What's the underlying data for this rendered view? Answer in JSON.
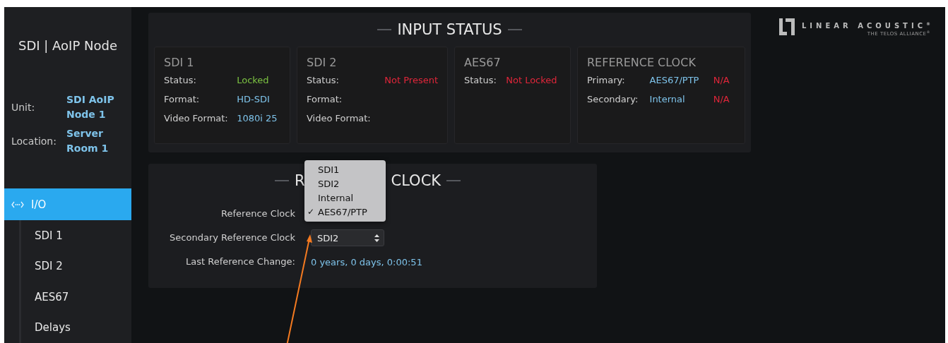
{
  "sidebar": {
    "title": "SDI | AoIP Node",
    "info": [
      {
        "label": "Unit:",
        "value": "SDI AoIP Node 1"
      },
      {
        "label": "Location:",
        "value": "Server Room 1"
      }
    ],
    "nav": [
      {
        "label": "I/O",
        "selected": true,
        "children": [
          {
            "label": "SDI 1",
            "selected": false
          },
          {
            "label": "SDI 2",
            "selected": false
          },
          {
            "label": "AES67",
            "selected": false
          },
          {
            "label": "Delays",
            "selected": false
          }
        ]
      }
    ]
  },
  "input_status": {
    "title": "INPUT STATUS",
    "cards": [
      {
        "title": "SDI 1",
        "rows": [
          {
            "label": "Status:",
            "value": "Locked",
            "color": "#7cc242"
          },
          {
            "label": "Format:",
            "value": "HD-SDI",
            "color": "#7ec3ea"
          },
          {
            "label": "Video Format:",
            "value": "1080i 25",
            "color": "#7ec3ea"
          }
        ]
      },
      {
        "title": "SDI 2",
        "rows": [
          {
            "label": "Status:",
            "value": "Not Present",
            "color": "#e0263a"
          },
          {
            "label": "Format:"
          },
          {
            "label": "Video Format:"
          }
        ]
      },
      {
        "title": "AES67",
        "rows": [
          {
            "label": "Status:",
            "value": "Not Locked",
            "color": "#e0263a"
          }
        ]
      },
      {
        "title": "REFERENCE CLOCK",
        "rows": [
          {
            "label": "Primary:",
            "value": "AES67/PTP",
            "color": "#7ec3ea",
            "state": "N/A"
          },
          {
            "label": "Secondary:",
            "value": "Internal",
            "color": "#7ec3ea",
            "state": "N/A"
          }
        ]
      }
    ]
  },
  "reference_clock": {
    "title_parts": [
      "R",
      "CLOCK"
    ],
    "reference_clock": {
      "label": "Reference Clock",
      "options": [
        {
          "label": "SDI1",
          "selected": false
        },
        {
          "label": "SDI2",
          "selected": false
        },
        {
          "label": "Internal",
          "selected": false
        },
        {
          "label": "AES67/PTP",
          "selected": true
        }
      ],
      "check": "✓"
    },
    "secondary": {
      "label": "Secondary Reference Clock",
      "value": "SDI2"
    },
    "last_change": {
      "label": "Last Reference Change:",
      "value": "0 years, 0 days, 0:00:51"
    }
  },
  "logo": {
    "name": "LINEAR ACOUSTIC",
    "mark": "®",
    "tagline": "THE TELOS ALLIANCE",
    "tagline_mark": "®"
  }
}
